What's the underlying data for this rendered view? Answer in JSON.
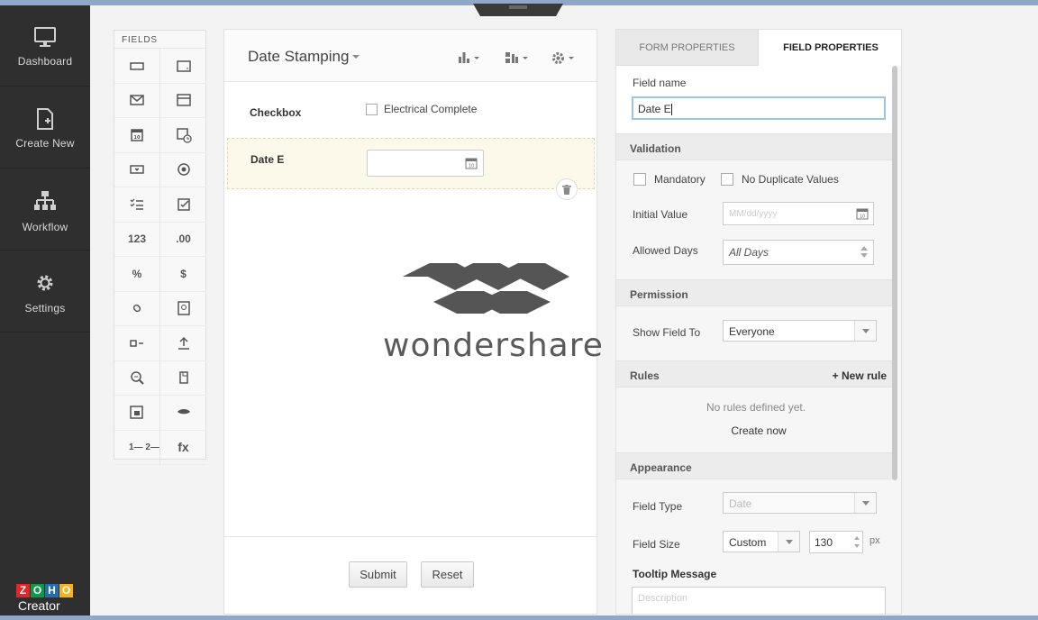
{
  "nav": {
    "items": [
      {
        "label": "Dashboard",
        "icon": "monitor-icon"
      },
      {
        "label": "Create New",
        "icon": "new-document-icon"
      },
      {
        "label": "Workflow",
        "icon": "workflow-icon"
      },
      {
        "label": "Settings",
        "icon": "gear-icon"
      }
    ],
    "logo_letters": [
      "Z",
      "O",
      "H",
      "O"
    ],
    "logo_colors": [
      "#e42527",
      "#089949",
      "#226db4",
      "#f9b21d"
    ],
    "logo_text": "Creator"
  },
  "fields_palette": {
    "header": "FIELDS",
    "items": [
      {
        "icon": "single-line-icon"
      },
      {
        "icon": "multi-line-icon"
      },
      {
        "icon": "email-icon"
      },
      {
        "icon": "rich-text-icon"
      },
      {
        "icon": "date-icon"
      },
      {
        "icon": "date-time-icon"
      },
      {
        "icon": "dropdown-icon"
      },
      {
        "icon": "radio-icon"
      },
      {
        "icon": "multi-select-icon"
      },
      {
        "icon": "checkbox-icon"
      },
      {
        "text": "123",
        "icon": "number-icon"
      },
      {
        "text": ".00",
        "icon": "decimal-icon"
      },
      {
        "text": "%",
        "icon": "percent-icon"
      },
      {
        "text": "$",
        "icon": "currency-icon"
      },
      {
        "icon": "url-icon"
      },
      {
        "icon": "image-icon"
      },
      {
        "icon": "decision-box-icon"
      },
      {
        "icon": "upload-icon"
      },
      {
        "icon": "lookup-icon"
      },
      {
        "icon": "subform-icon"
      },
      {
        "icon": "section-icon"
      },
      {
        "icon": "users-icon"
      },
      {
        "text": "1— 2—",
        "icon": "auto-number-icon"
      },
      {
        "text": "fx",
        "icon": "formula-icon"
      }
    ]
  },
  "form": {
    "title": "Date Stamping",
    "rows": [
      {
        "label": "Checkbox",
        "option": "Electrical Complete"
      },
      {
        "label": "Date E"
      }
    ],
    "submit_label": "Submit",
    "reset_label": "Reset"
  },
  "watermark": {
    "text": "wondershare"
  },
  "props": {
    "tabs": [
      {
        "label": "FORM PROPERTIES",
        "active": false
      },
      {
        "label": "FIELD PROPERTIES",
        "active": true
      }
    ],
    "field_name_label": "Field name",
    "field_name_value": "Date E",
    "validation": {
      "title": "Validation",
      "mandatory": "Mandatory",
      "no_duplicate": "No Duplicate Values",
      "initial_value_label": "Initial Value",
      "initial_value_placeholder": "MM/dd/yyyy",
      "allowed_days_label": "Allowed Days",
      "allowed_days_value": "All Days"
    },
    "permission": {
      "title": "Permission",
      "show_field_label": "Show Field To",
      "show_field_value": "Everyone"
    },
    "rules": {
      "title": "Rules",
      "new_rule": "+ New rule",
      "empty_text": "No rules defined yet.",
      "create_now": "Create now"
    },
    "appearance": {
      "title": "Appearance",
      "field_type_label": "Field Type",
      "field_type_value": "Date",
      "field_size_label": "Field Size",
      "field_size_value": "Custom",
      "field_size_px": "130",
      "px_unit": "px",
      "tooltip_label": "Tooltip Message",
      "tooltip_placeholder": "Description"
    }
  }
}
